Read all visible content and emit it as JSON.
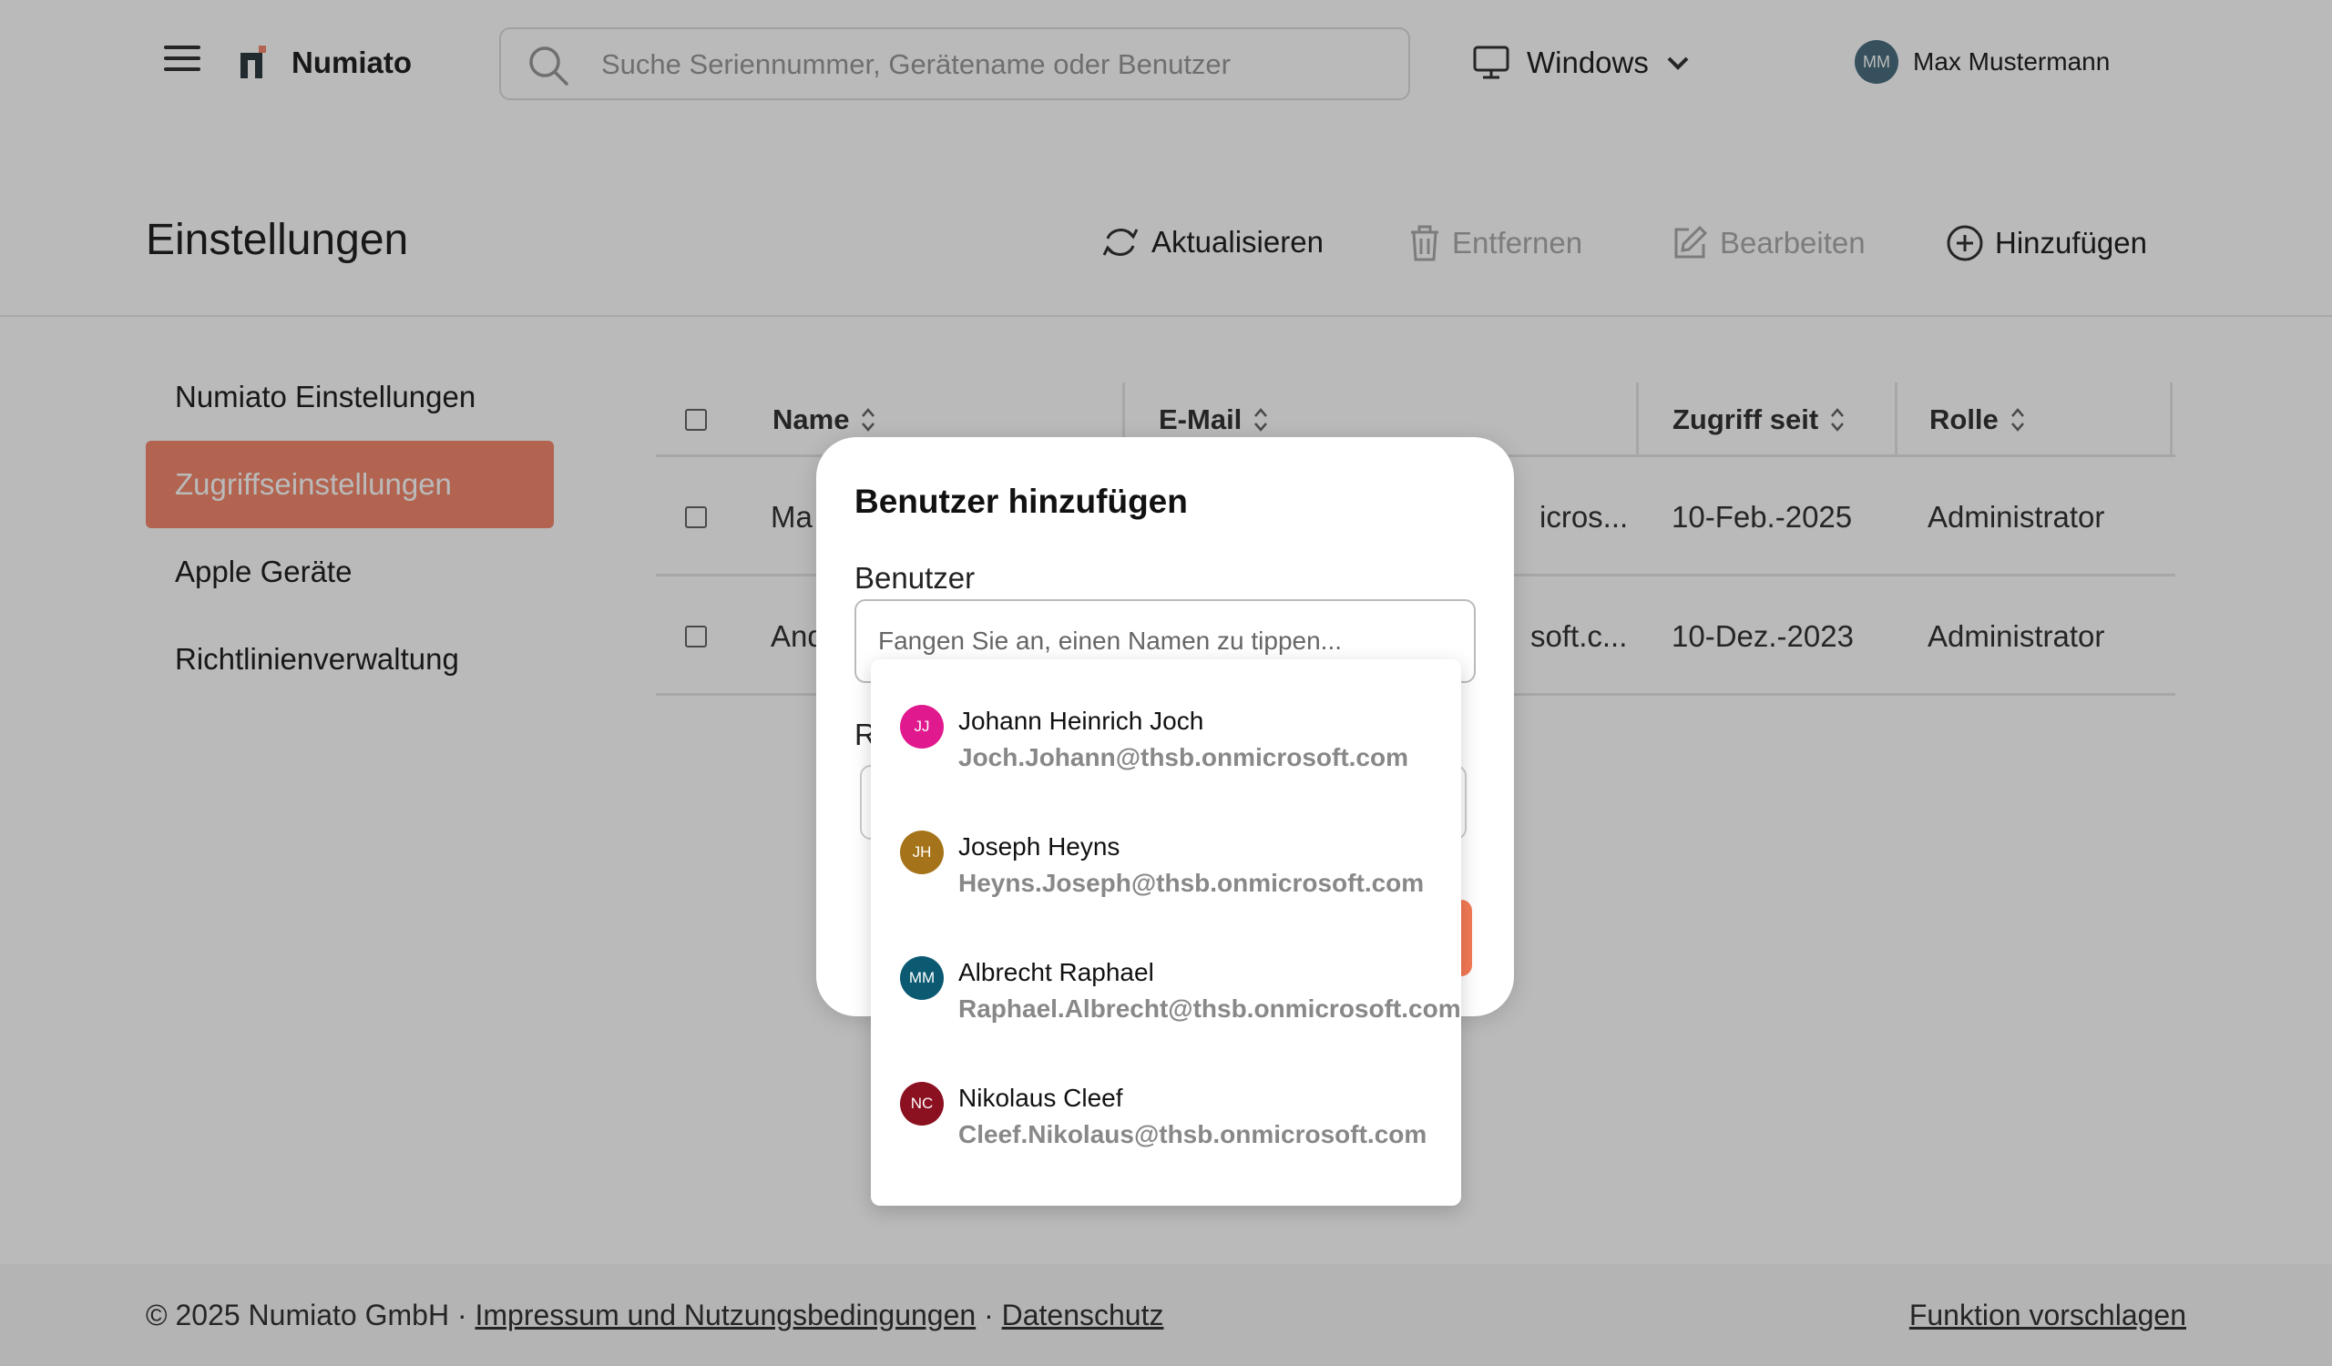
{
  "header": {
    "app_name": "Numiato",
    "search_placeholder": "Suche Seriennummer, Gerätename oder Benutzer",
    "os_label": "Windows",
    "user_initials": "MM",
    "user_name": "Max Mustermann"
  },
  "page": {
    "title": "Einstellungen",
    "actions": {
      "refresh": "Aktualisieren",
      "remove": "Entfernen",
      "edit": "Bearbeiten",
      "add": "Hinzufügen"
    }
  },
  "sidebar": {
    "items": [
      {
        "label": "Numiato Einstellungen"
      },
      {
        "label": "Zugriffseinstellungen",
        "active": true
      },
      {
        "label": "Apple Geräte"
      },
      {
        "label": "Richtlinienverwaltung"
      }
    ]
  },
  "table": {
    "columns": [
      "Name",
      "E-Mail",
      "Zugriff seit",
      "Rolle"
    ],
    "rows": [
      {
        "name": "Ma",
        "email": "icros...",
        "since": "10-Feb.-2025",
        "role": "Administrator"
      },
      {
        "name": "And",
        "email": "soft.c...",
        "since": "10-Dez.-2023",
        "role": "Administrator"
      }
    ]
  },
  "modal": {
    "title": "Benutzer hinzufügen",
    "user_label": "Benutzer",
    "user_placeholder": "Fangen Sie an, einen Namen zu tippen...",
    "role_label_peek": "R"
  },
  "dropdown": {
    "options": [
      {
        "initials": "JJ",
        "name": "Johann Heinrich Joch",
        "email": "Joch.Johann@thsb.onmicrosoft.com",
        "color": "#e0198e"
      },
      {
        "initials": "JH",
        "name": "Joseph Heyns",
        "email": "Heyns.Joseph@thsb.onmicrosoft.com",
        "color": "#a5741a"
      },
      {
        "initials": "MM",
        "name": "Albrecht Raphael",
        "email": "Raphael.Albrecht@thsb.onmicrosoft.com",
        "color": "#0b5a72"
      },
      {
        "initials": "NC",
        "name": "Nikolaus Cleef",
        "email": "Cleef.Nikolaus@thsb.onmicrosoft.com",
        "color": "#8b1020"
      }
    ]
  },
  "footer": {
    "copyright": "© 2025 Numiato GmbH · ",
    "imprint": "Impressum und Nutzungsbedingungen",
    "separator": " · ",
    "privacy": "Datenschutz",
    "suggest": "Funktion vorschlagen"
  },
  "colors": {
    "accent": "#f58a6e",
    "brand_dark": "#2e3a40",
    "overlay": "rgba(0,0,0,0.27)"
  }
}
